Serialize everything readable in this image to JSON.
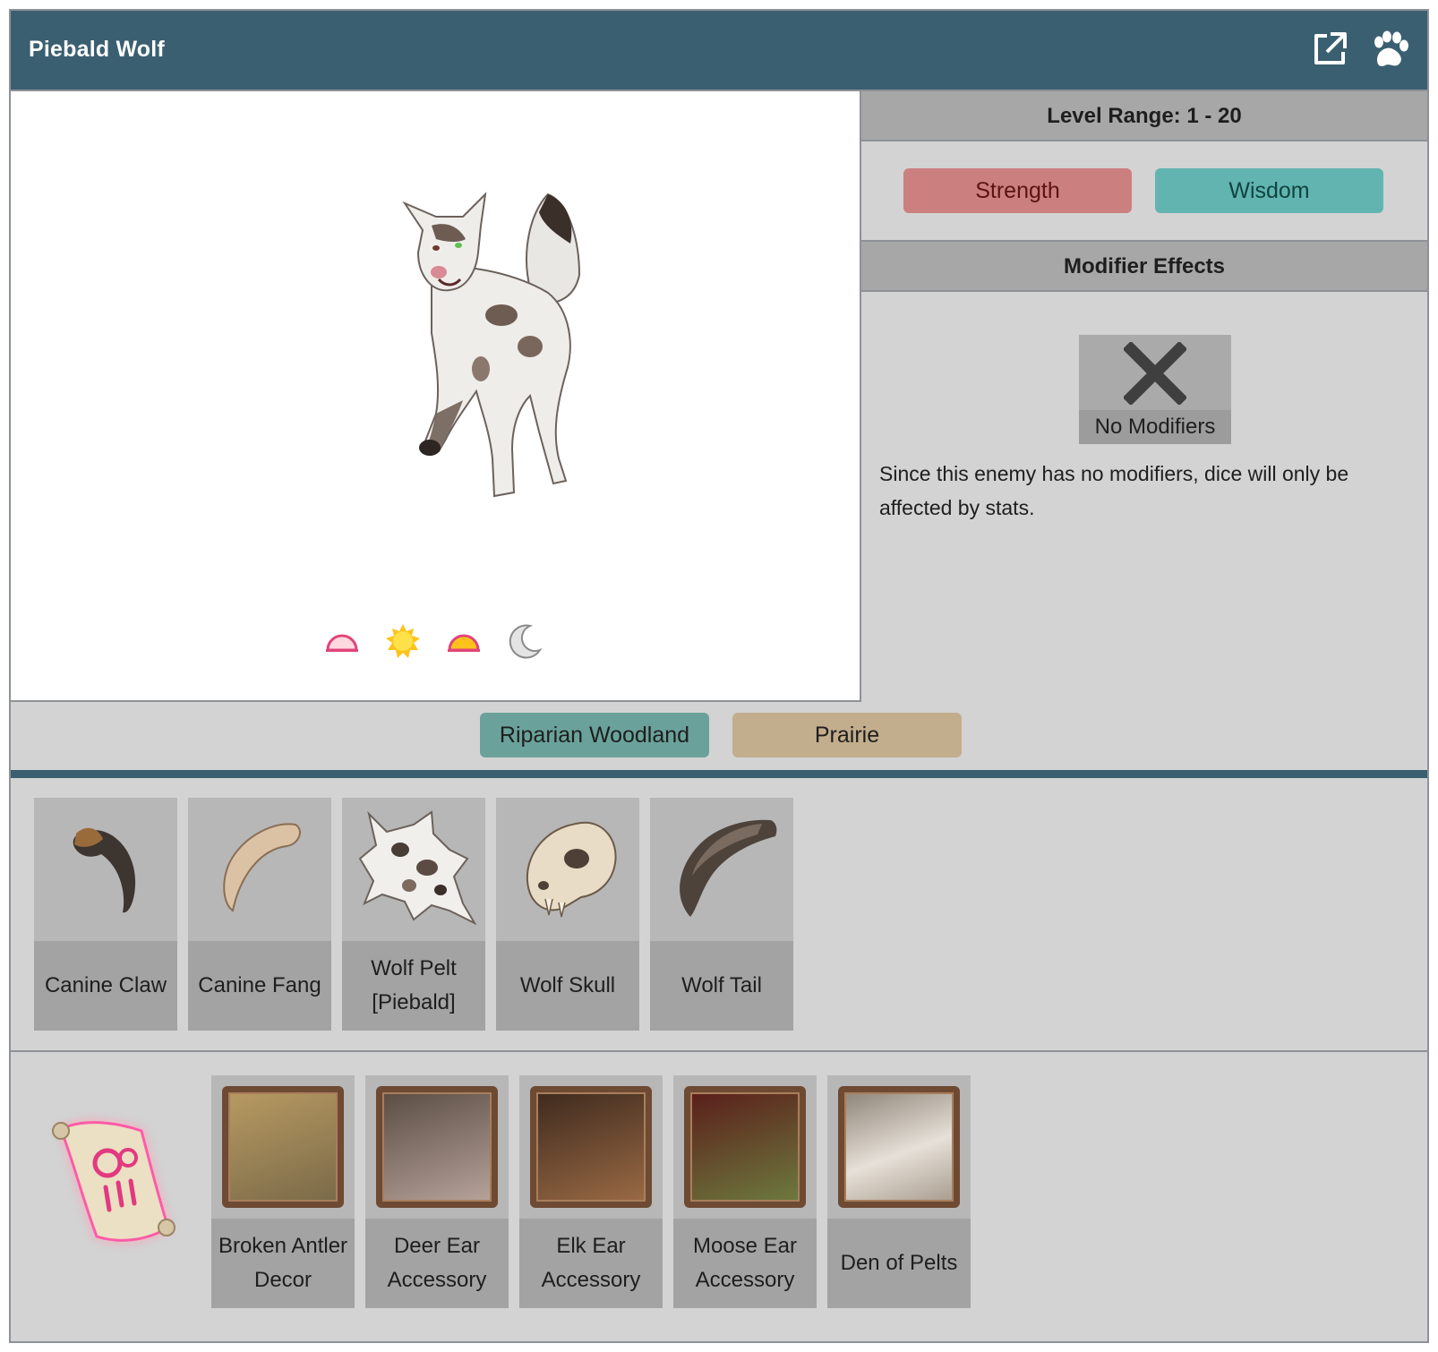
{
  "header": {
    "title": "Piebald Wolf",
    "icons": [
      "external-link-icon",
      "paw-icon"
    ]
  },
  "portrait": {
    "creature": "piebald-wolf-illustration",
    "time_icons": [
      "dawn-icon",
      "day-icon",
      "dusk-icon",
      "night-icon"
    ]
  },
  "level": {
    "label": "Level Range: 1 - 20"
  },
  "stats": {
    "items": [
      {
        "label": "Strength",
        "color": "#cc7f7f"
      },
      {
        "label": "Wisdom",
        "color": "#62b4b0"
      }
    ]
  },
  "modifiers": {
    "heading": "Modifier Effects",
    "none_label": "No Modifiers",
    "none_icon": "x-icon",
    "description": "Since this enemy has no modifiers, dice will only be affected by stats."
  },
  "habitats": {
    "items": [
      {
        "label": "Riparian Woodland",
        "color": "#6aa29b"
      },
      {
        "label": "Prairie",
        "color": "#c2ae8c"
      }
    ]
  },
  "drops": {
    "items": [
      {
        "label": "Canine Claw",
        "icon": "claw-icon"
      },
      {
        "label": "Canine Fang",
        "icon": "fang-icon"
      },
      {
        "label": "Wolf Pelt [Piebald]",
        "icon": "pelt-icon"
      },
      {
        "label": "Wolf Skull",
        "icon": "skull-icon"
      },
      {
        "label": "Wolf Tail",
        "icon": "tail-icon"
      }
    ]
  },
  "crafts": {
    "recipe_icon": "scroll-icon",
    "items": [
      {
        "label": "Broken Antler Decor",
        "icon": "antler-icon"
      },
      {
        "label": "Deer Ear Accessory",
        "icon": "deer-ear-icon"
      },
      {
        "label": "Elk Ear Accessory",
        "icon": "elk-ear-icon"
      },
      {
        "label": "Moose Ear Accessory",
        "icon": "moose-ear-icon"
      },
      {
        "label": "Den of Pelts",
        "icon": "fur-icon"
      }
    ]
  }
}
